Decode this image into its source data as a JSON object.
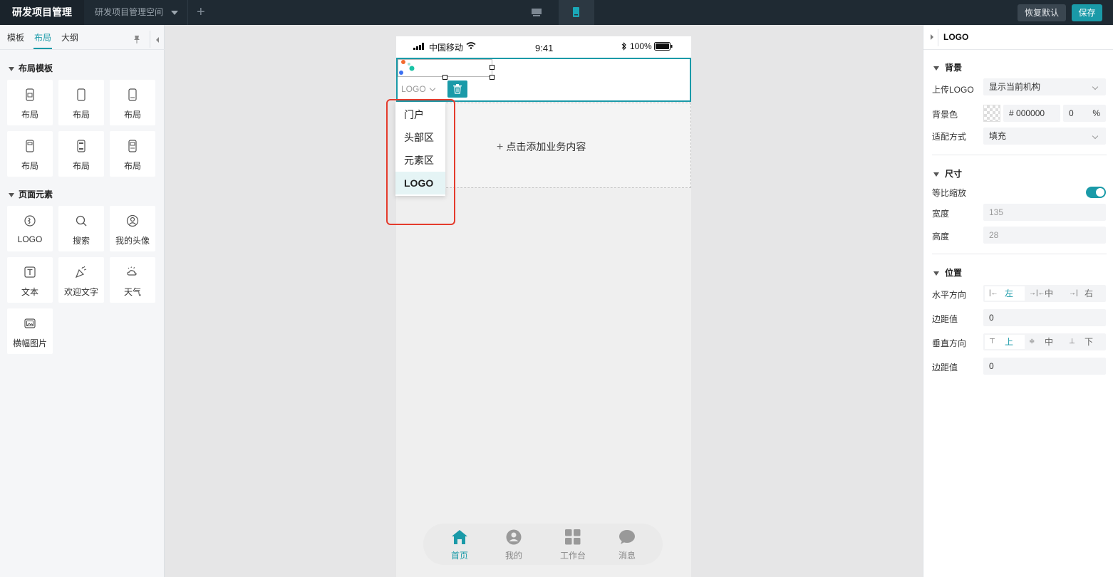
{
  "topbar": {
    "app_title": "研发项目管理",
    "workspace": "研发项目管理空间",
    "add_tab": "+",
    "restore_label": "恢复默认",
    "save_label": "保存"
  },
  "left": {
    "tabs": [
      "模板",
      "布局",
      "大纲"
    ],
    "active_tab": "布局",
    "section_layout": "布局模板",
    "layout_items": [
      "布局",
      "布局",
      "布局",
      "布局",
      "布局",
      "布局"
    ],
    "section_elements": "页面元素",
    "element_items": [
      {
        "label": "LOGO",
        "icon": "logo-icon"
      },
      {
        "label": "搜索",
        "icon": "search-icon"
      },
      {
        "label": "我的头像",
        "icon": "avatar-icon"
      },
      {
        "label": "文本",
        "icon": "text-icon"
      },
      {
        "label": "欢迎文字",
        "icon": "welcome-icon"
      },
      {
        "label": "天气",
        "icon": "weather-icon"
      },
      {
        "label": "横幅图片",
        "icon": "banner-icon"
      }
    ]
  },
  "phone": {
    "carrier": "中国移动",
    "time": "9:41",
    "battery": "100%",
    "logo_tag": "LOGO",
    "add_content": "点击添加业务内容",
    "tabs": [
      {
        "label": "首页",
        "icon": "home-icon",
        "active": true
      },
      {
        "label": "我的",
        "icon": "user-icon",
        "active": false
      },
      {
        "label": "工作台",
        "icon": "grid-icon",
        "active": false
      },
      {
        "label": "消息",
        "icon": "message-icon",
        "active": false
      }
    ]
  },
  "dropdown": {
    "items": [
      "门户",
      "头部区",
      "元素区",
      "LOGO"
    ],
    "selected": "LOGO"
  },
  "right": {
    "title": "LOGO",
    "sec_bg": "背景",
    "upload_label": "上传LOGO",
    "upload_value": "显示当前机构",
    "bgcolor_label": "背景色",
    "bgcolor_hash": "#",
    "bgcolor_value": "000000",
    "bgcolor_opacity": "0",
    "bgcolor_unit": "%",
    "fit_label": "适配方式",
    "fit_value": "填充",
    "sec_size": "尺寸",
    "ratio_label": "等比缩放",
    "width_label": "宽度",
    "width_value": "135",
    "height_label": "高度",
    "height_value": "28",
    "sec_pos": "位置",
    "h_label": "水平方向",
    "h_options": [
      "左",
      "中",
      "右"
    ],
    "h_selected": "左",
    "h_margin_label": "边距值",
    "h_margin_value": "0",
    "v_label": "垂直方向",
    "v_options": [
      "上",
      "中",
      "下"
    ],
    "v_selected": "上",
    "v_margin_label": "边距值",
    "v_margin_value": "0"
  },
  "colors": {
    "accent": "#1a9aa8",
    "topbar": "#1f2a33",
    "highlight": "#e43b2c"
  }
}
